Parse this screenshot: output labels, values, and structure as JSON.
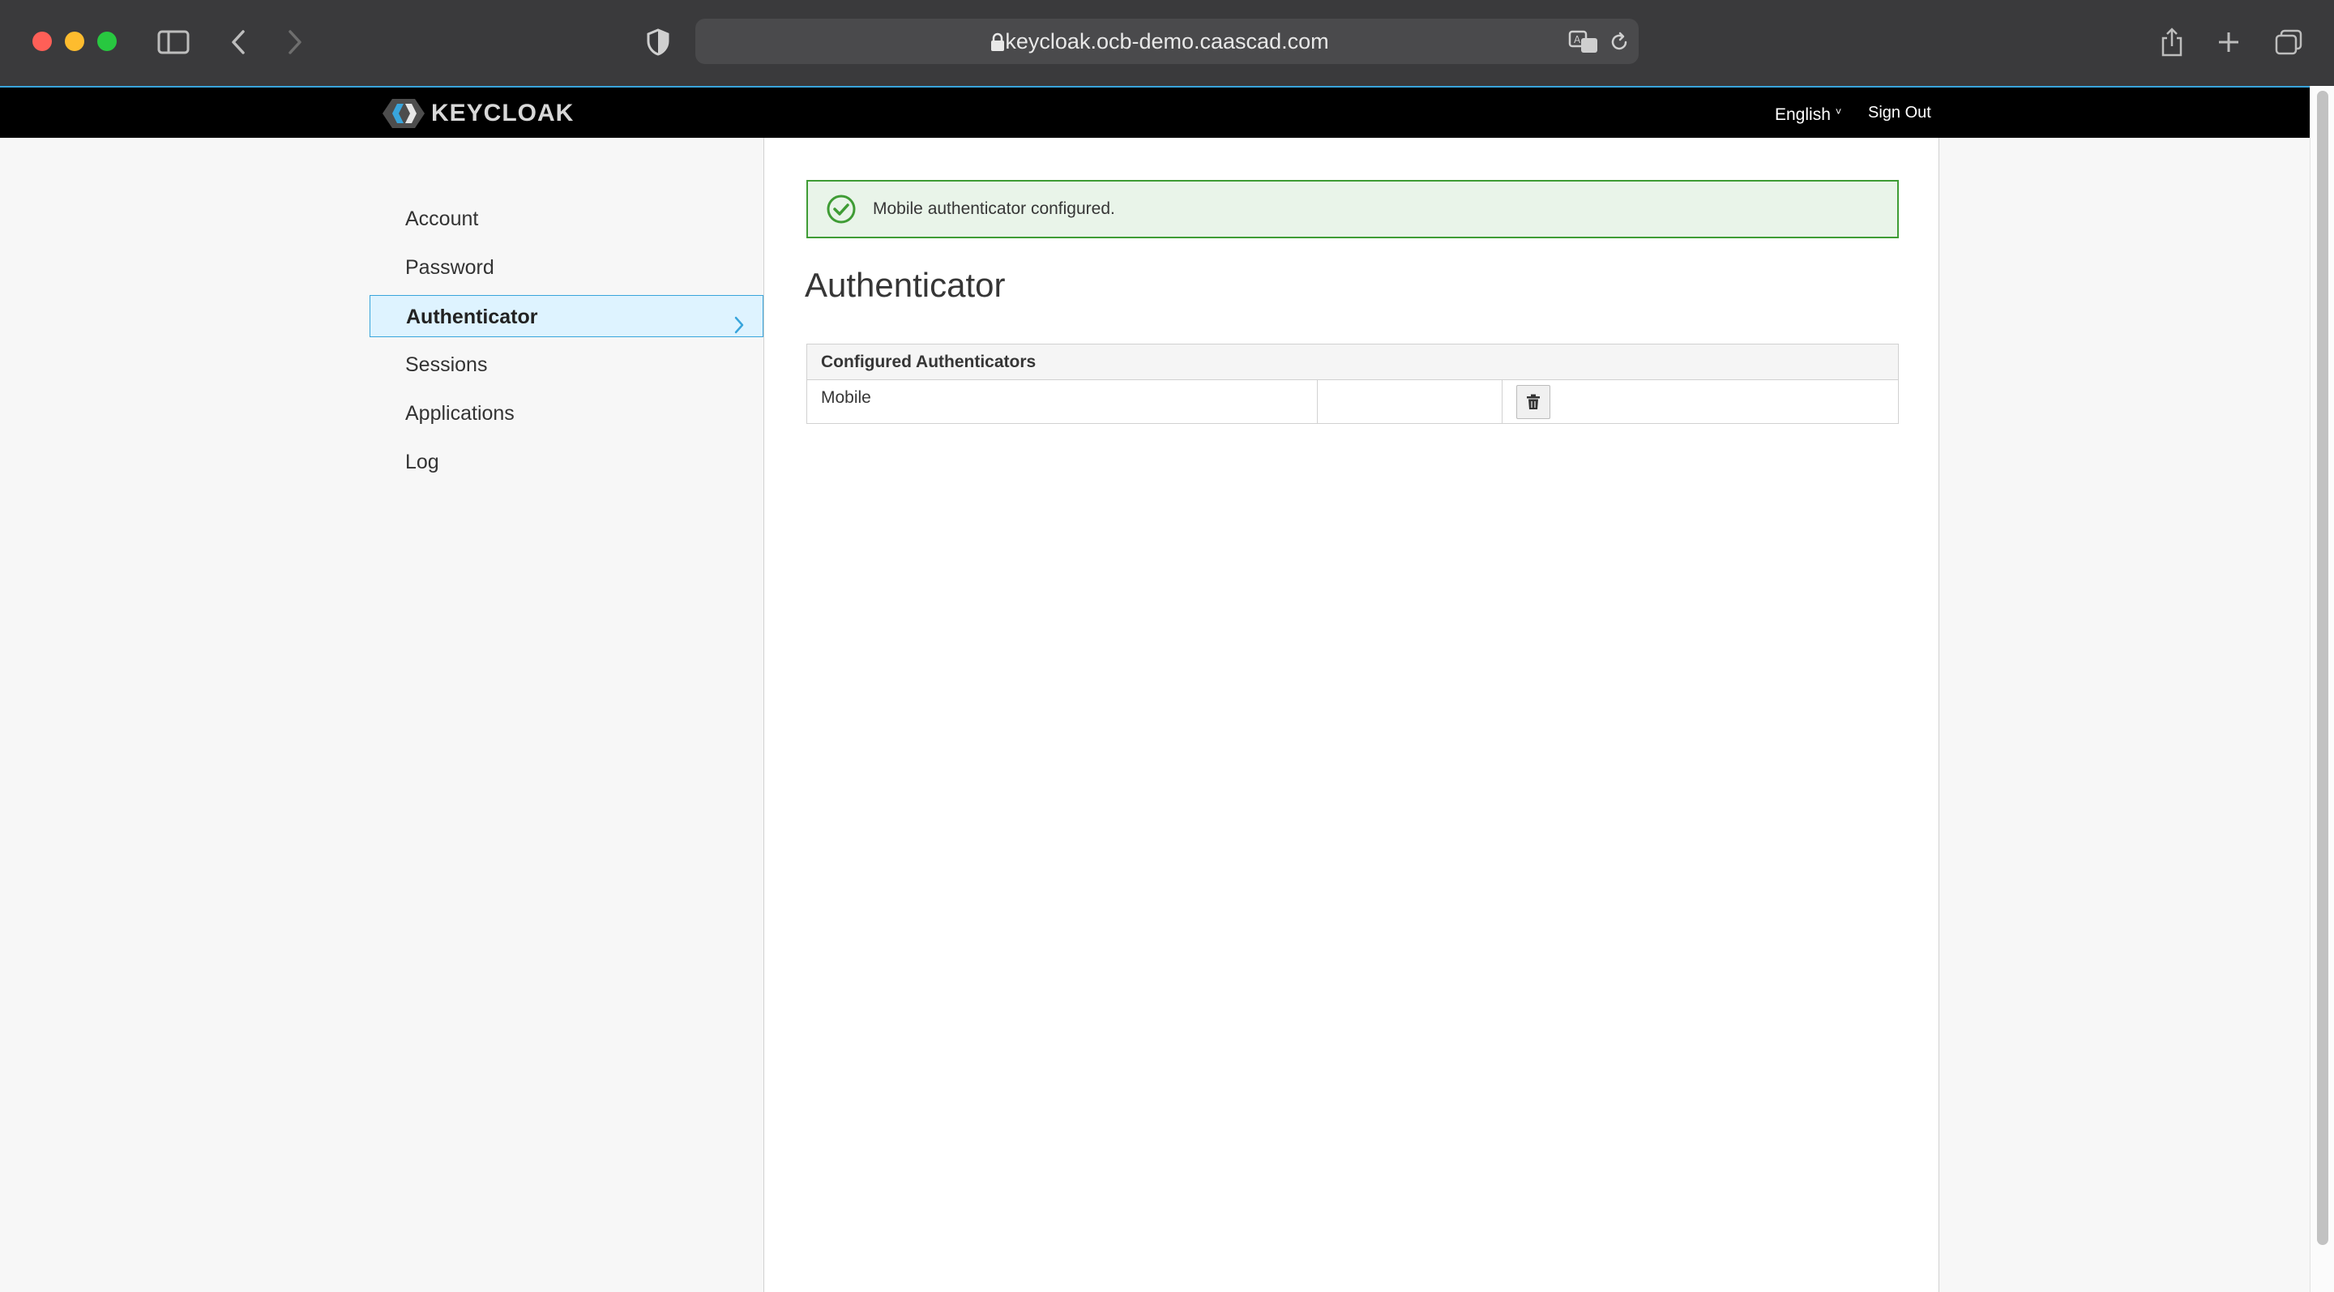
{
  "browser": {
    "url": "keycloak.ocb-demo.caascad.com",
    "icons": [
      "sidebar-toggle-icon",
      "back-icon",
      "forward-icon",
      "shield-icon",
      "lock-icon",
      "translate-icon",
      "reload-icon",
      "share-icon",
      "new-tab-icon",
      "tabs-overview-icon"
    ]
  },
  "header": {
    "logo_text": "KEYCLOAK",
    "language": "English",
    "sign_out": "Sign Out"
  },
  "sidebar": {
    "items": [
      {
        "label": "Account",
        "active": false
      },
      {
        "label": "Password",
        "active": false
      },
      {
        "label": "Authenticator",
        "active": true
      },
      {
        "label": "Sessions",
        "active": false
      },
      {
        "label": "Applications",
        "active": false
      },
      {
        "label": "Log",
        "active": false
      }
    ]
  },
  "alert": {
    "type": "success",
    "message": "Mobile authenticator configured."
  },
  "main": {
    "title": "Authenticator",
    "table": {
      "header": "Configured Authenticators",
      "rows": [
        {
          "name": "Mobile",
          "detail": "",
          "action": "trash-icon"
        }
      ]
    }
  },
  "colors": {
    "accent": "#39a5dc",
    "success": "#3f9c35",
    "active_bg": "#def3ff"
  }
}
